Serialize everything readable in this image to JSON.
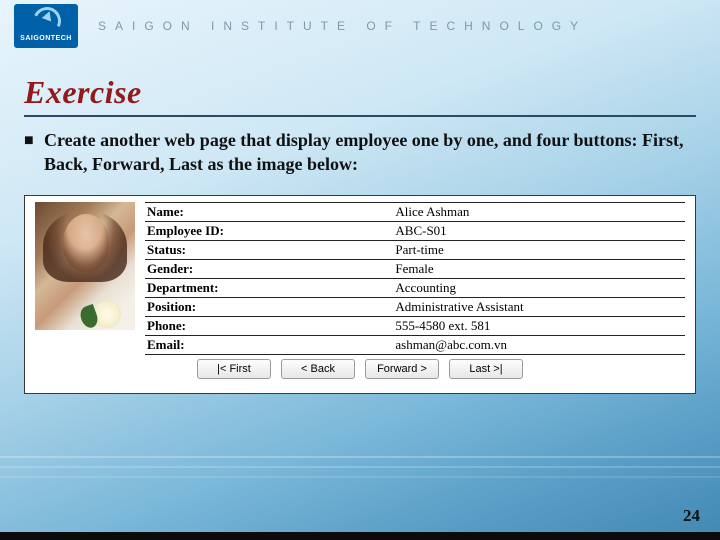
{
  "header": {
    "logo_text": "SAIGONTECH",
    "institution": "SAIGON INSTITUTE OF TECHNOLOGY"
  },
  "title": "Exercise",
  "bullet_text": "Create another web page that display employee one by one, and four buttons: First, Back, Forward, Last as the image below:",
  "employee": {
    "fields": [
      {
        "label": "Name:",
        "value": "Alice Ashman"
      },
      {
        "label": "Employee ID:",
        "value": "ABC-S01"
      },
      {
        "label": "Status:",
        "value": "Part-time"
      },
      {
        "label": "Gender:",
        "value": "Female"
      },
      {
        "label": "Department:",
        "value": "Accounting"
      },
      {
        "label": "Position:",
        "value": "Administrative Assistant"
      },
      {
        "label": "Phone:",
        "value": "555-4580 ext. 581"
      },
      {
        "label": "Email:",
        "value": "ashman@abc.com.vn"
      }
    ],
    "buttons": {
      "first": "|< First",
      "back": "< Back",
      "forward": "Forward >",
      "last": "Last >|"
    }
  },
  "page_number": "24"
}
